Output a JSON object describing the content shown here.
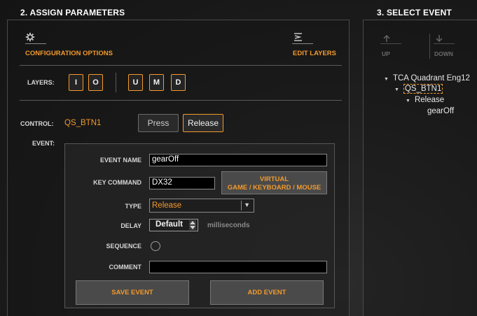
{
  "assign": {
    "title": "2. ASSIGN PARAMETERS",
    "config_label": "CONFIGURATION OPTIONS",
    "edit_layers_label": "EDIT LAYERS",
    "layers_label": "LAYERS:",
    "layers_left": [
      "I",
      "O"
    ],
    "layers_right": [
      "U",
      "M",
      "D"
    ],
    "control_label": "CONTROL:",
    "control_value": "QS_BTN1",
    "press_label": "Press",
    "release_label": "Release",
    "event_label": "EVENT:",
    "form": {
      "event_name_label": "EVENT NAME",
      "event_name_value": "gearOff",
      "key_command_label": "KEY COMMAND",
      "key_command_value": "DX32",
      "virtual_btn_line1": "VIRTUAL",
      "virtual_btn_line2": "GAME / KEYBOARD / MOUSE",
      "type_label": "TYPE",
      "type_value": "Release",
      "delay_label": "DELAY",
      "delay_value": "Default",
      "delay_unit": "milliseconds",
      "sequence_label": "SEQUENCE",
      "comment_label": "COMMENT",
      "comment_value": "",
      "save_label": "SAVE EVENT",
      "add_label": "ADD EVENT"
    }
  },
  "select": {
    "title": "3. SELECT EVENT",
    "up_label": "UP",
    "down_label": "DOWN",
    "tree": {
      "root": "TCA Quadrant Eng12",
      "child": "QS_BTN1",
      "grandchild": "Release",
      "leaf": "gearOff"
    }
  },
  "colors": {
    "accent": "#f39a2c",
    "background": "#1c1c1c"
  },
  "icons": {
    "config": "gear-icon",
    "edit_layers": "layers-edit-icon",
    "up": "arrow-up-icon",
    "down": "arrow-down-icon",
    "dropdown": "chevron-down-icon",
    "spinner": "spinner-arrows-icon"
  }
}
